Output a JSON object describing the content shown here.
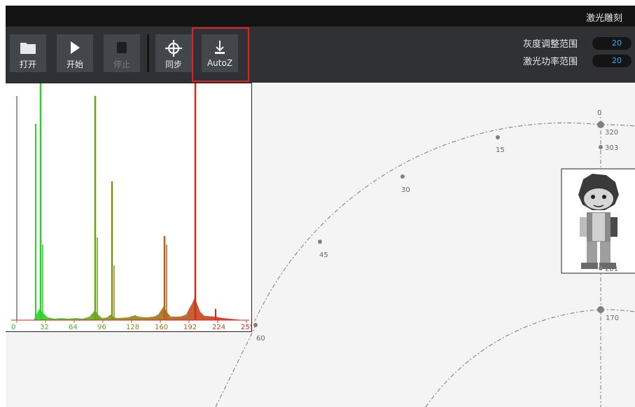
{
  "window": {
    "title": "激光雕刻"
  },
  "toolbar": {
    "buttons": [
      {
        "label": "打开",
        "icon": "folder-icon",
        "enabled": true
      },
      {
        "label": "开始",
        "icon": "play-icon",
        "enabled": true
      },
      {
        "label": "停止",
        "icon": "stop-icon",
        "enabled": false
      },
      {
        "label": "同步",
        "icon": "crosshair-icon",
        "enabled": true
      },
      {
        "label": "AutoZ",
        "icon": "z-arrow-icon",
        "enabled": true
      }
    ]
  },
  "params": [
    {
      "label": "灰度调整范围",
      "value": "20"
    },
    {
      "label": "激光功率范围",
      "value": "20"
    }
  ],
  "histogram": {
    "ticks": [
      "0",
      "32",
      "64",
      "96",
      "128",
      "160",
      "192",
      "224",
      "255"
    ]
  },
  "radial": {
    "angle_labels": [
      "0",
      "15",
      "30",
      "45",
      "60"
    ],
    "axis_values": [
      "320",
      "303",
      "170"
    ],
    "image_value": "201"
  },
  "colors": {
    "highlight": "#e02222",
    "field_text": "#2bb3ff",
    "toolbar_bg": "#2f3135"
  }
}
